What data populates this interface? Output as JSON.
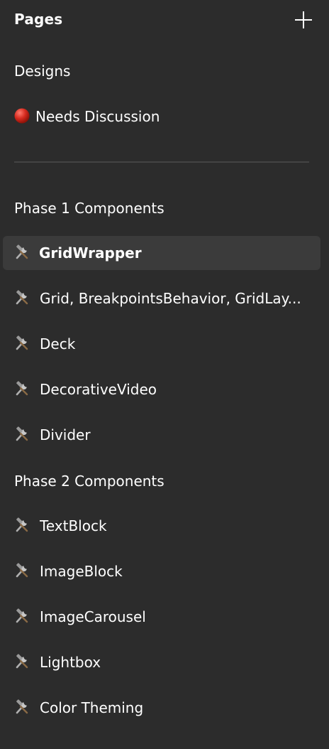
{
  "header": {
    "title": "Pages",
    "add_icon": "plus-icon"
  },
  "pages": [
    {
      "label": "Designs"
    },
    {
      "label": "Needs Discussion",
      "icon": "red-circle-icon",
      "icon_color": "#d32f2f"
    }
  ],
  "sections": [
    {
      "title": "Phase 1 Components",
      "items": [
        {
          "label": "GridWrapper",
          "icon": "hammer-wrench-icon",
          "selected": true
        },
        {
          "label": "Grid, BreakpointsBehavior, GridLay...",
          "icon": "hammer-wrench-icon"
        },
        {
          "label": "Deck",
          "icon": "hammer-wrench-icon"
        },
        {
          "label": "DecorativeVideo",
          "icon": "hammer-wrench-icon"
        },
        {
          "label": "Divider",
          "icon": "hammer-wrench-icon"
        }
      ]
    },
    {
      "title": "Phase 2 Components",
      "items": [
        {
          "label": "TextBlock",
          "icon": "hammer-wrench-icon"
        },
        {
          "label": "ImageBlock",
          "icon": "hammer-wrench-icon"
        },
        {
          "label": "ImageCarousel",
          "icon": "hammer-wrench-icon"
        },
        {
          "label": "Lightbox",
          "icon": "hammer-wrench-icon"
        },
        {
          "label": "Color Theming",
          "icon": "hammer-wrench-icon"
        }
      ]
    }
  ],
  "colors": {
    "background": "#2c2c2c",
    "selected": "#3b3b3b",
    "divider": "#444444",
    "text": "#ffffff"
  }
}
